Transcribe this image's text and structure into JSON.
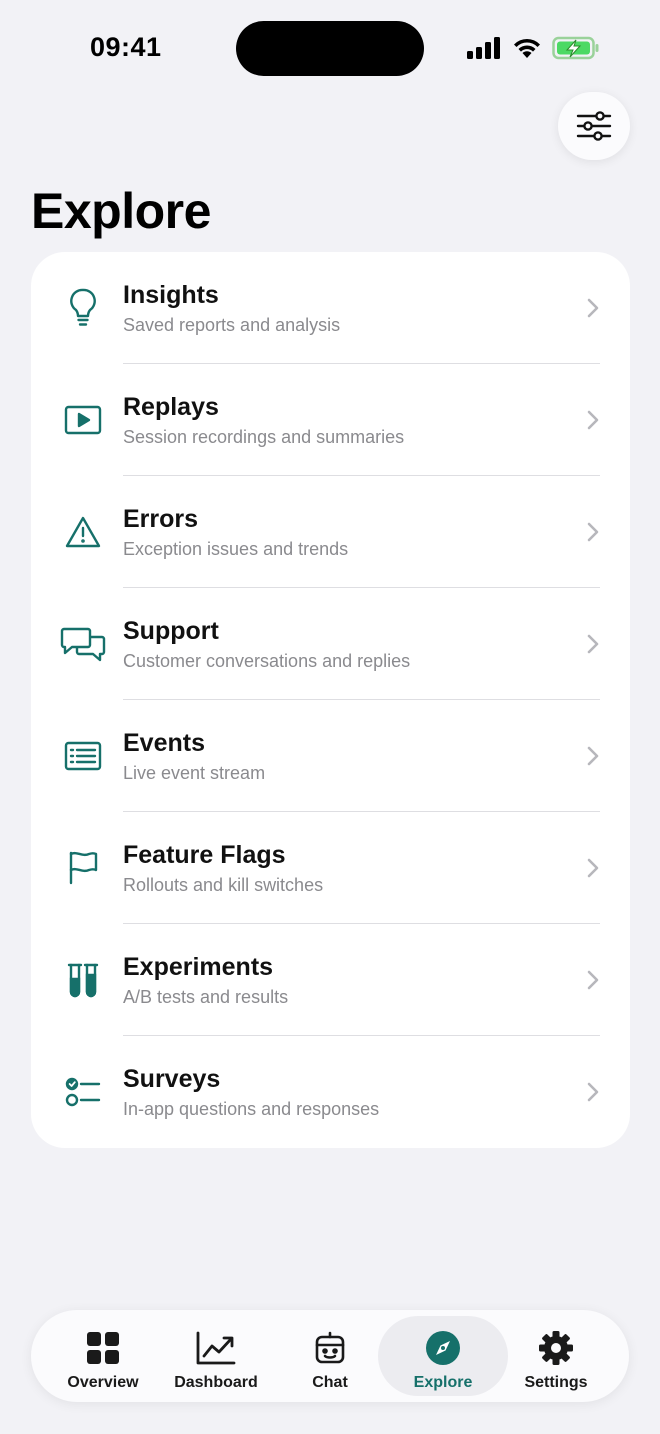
{
  "status_bar": {
    "time": "09:41"
  },
  "header": {
    "title": "Explore",
    "filter_icon": "sliders-icon"
  },
  "colors": {
    "accent": "#16706a",
    "background": "#f2f2f6",
    "card": "#ffffff",
    "subtitle": "#8a8a8e"
  },
  "items": [
    {
      "title": "Insights",
      "subtitle": "Saved reports and analysis",
      "icon": "lightbulb-icon"
    },
    {
      "title": "Replays",
      "subtitle": "Session recordings and summaries",
      "icon": "play-icon"
    },
    {
      "title": "Errors",
      "subtitle": "Exception issues and trends",
      "icon": "warning-icon"
    },
    {
      "title": "Support",
      "subtitle": "Customer conversations and replies",
      "icon": "chat-bubbles-icon"
    },
    {
      "title": "Events",
      "subtitle": "Live event stream",
      "icon": "list-icon"
    },
    {
      "title": "Feature Flags",
      "subtitle": "Rollouts and kill switches",
      "icon": "flag-icon"
    },
    {
      "title": "Experiments",
      "subtitle": "A/B tests and results",
      "icon": "test-tubes-icon"
    },
    {
      "title": "Surveys",
      "subtitle": "In-app questions and responses",
      "icon": "checklist-icon"
    }
  ],
  "tabbar": {
    "tabs": [
      {
        "label": "Overview",
        "icon": "grid-icon"
      },
      {
        "label": "Dashboard",
        "icon": "line-chart-icon"
      },
      {
        "label": "Chat",
        "icon": "robot-icon"
      },
      {
        "label": "Explore",
        "icon": "compass-icon",
        "active": true
      },
      {
        "label": "Settings",
        "icon": "gear-icon"
      }
    ]
  }
}
